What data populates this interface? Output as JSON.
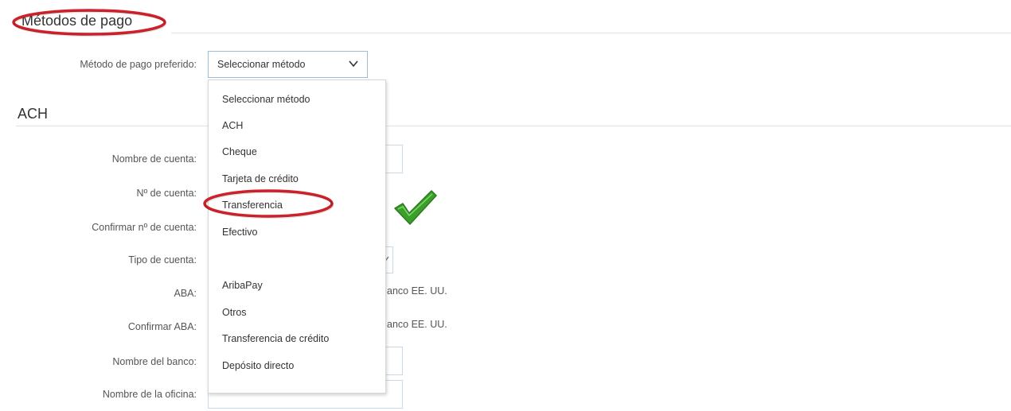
{
  "payment_section": {
    "title": "Métodos de pago",
    "preferred_label": "Método de pago preferido:",
    "preferred_value": "Seleccionar método"
  },
  "dropdown": {
    "options": [
      "Seleccionar método",
      "ACH",
      "Cheque",
      "Tarjeta de crédito",
      "Transferencia",
      "Efectivo",
      "AribaPay",
      "Otros",
      "Transferencia de crédito",
      "Depósito directo"
    ],
    "highlighted": "Transferencia"
  },
  "ach_section": {
    "title": "ACH",
    "labels": {
      "account_name": "Nombre de cuenta:",
      "account_number": "Nº de cuenta:",
      "confirm_account_number": "Confirmar nº de cuenta:",
      "account_type": "Tipo de cuenta:",
      "aba": "ABA:",
      "confirm_aba": "Confirmar ABA:",
      "bank_name": "Nombre del banco:",
      "branch_name": "Nombre de la oficina:"
    },
    "aba_hint_fragment": "anco EE. UU.",
    "confirm_aba_hint_fragment": "anco EE. UU."
  },
  "annotations": {
    "ring_color": "#d0202a",
    "checkmark_color": "#3aa02a",
    "checkmark_icon": "check-icon"
  }
}
